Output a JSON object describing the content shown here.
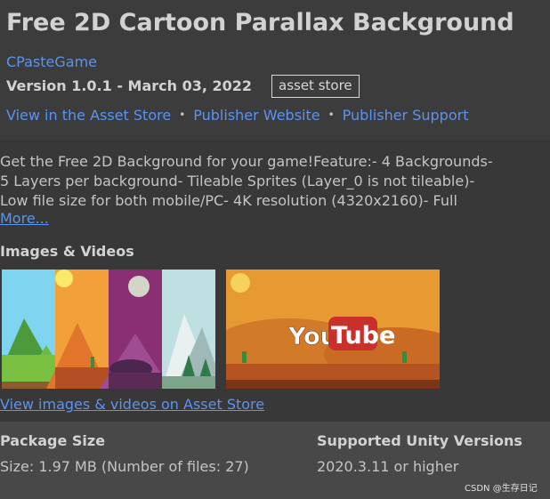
{
  "header": {
    "title": "Free 2D Cartoon Parallax Background",
    "publisher": "CPasteGame",
    "version": "Version 1.0.1 - March 03, 2022",
    "badge": "asset store",
    "links": [
      {
        "label": "View in the Asset Store"
      },
      {
        "label": "Publisher Website"
      },
      {
        "label": "Publisher Support"
      }
    ],
    "link_separator": "•"
  },
  "description": {
    "lines": [
      "Get the Free 2D Background for your game!Feature:- 4 Backgrounds-",
      "5 Layers per background- Tileable Sprites (Layer_0 is not tileable)-",
      "Low file size for both mobile/PC- 4K resolution (4320x2160)- Full"
    ],
    "more_label": "More..."
  },
  "media": {
    "heading": "Images & Videos",
    "thumbnails": [
      {
        "kind": "image-icon"
      },
      {
        "kind": "video-icon",
        "logo": "YouTube"
      }
    ],
    "view_label": "View images & videos on Asset Store"
  },
  "footer": {
    "package_size_label": "Package Size",
    "package_size_value": "Size: 1.97 MB (Number of files: 27)",
    "unity_label": "Supported Unity Versions",
    "unity_value": "2020.3.11 or higher",
    "watermark": "CSDN @生存日记"
  },
  "colors": {
    "background": "#383838",
    "header": "#3c3c3c",
    "footer": "#484848",
    "link": "#5b93f0",
    "text": "#c4c4c4"
  }
}
